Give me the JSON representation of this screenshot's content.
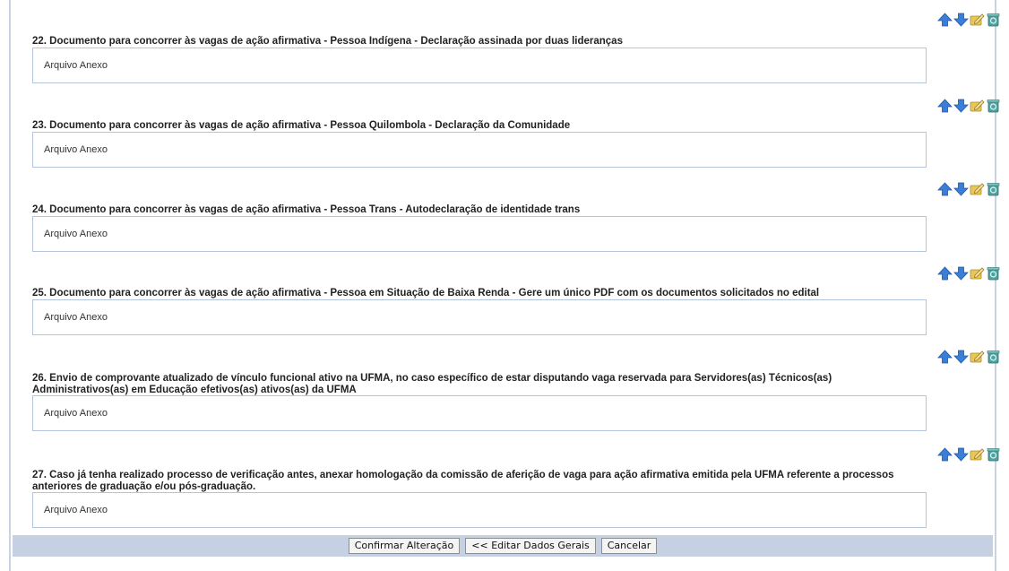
{
  "questions": [
    {
      "label": "22. Documento para concorrer às vagas de ação afirmativa - Pessoa Indígena - Declaração assinada por duas lideranças",
      "answer": "Arquivo Anexo"
    },
    {
      "label": "23. Documento para concorrer às vagas de ação afirmativa - Pessoa Quilombola - Declaração da Comunidade",
      "answer": "Arquivo Anexo"
    },
    {
      "label": "24. Documento para concorrer às vagas de ação afirmativa - Pessoa Trans - Autodeclaração de identidade trans",
      "answer": "Arquivo Anexo"
    },
    {
      "label": "25. Documento para concorrer às vagas de ação afirmativa - Pessoa em Situação de Baixa Renda - Gere um único PDF com os documentos solicitados no edital",
      "answer": "Arquivo Anexo"
    },
    {
      "label": "26. Envio de comprovante atualizado de vínculo funcional ativo na UFMA, no caso específico de estar disputando vaga reservada para Servidores(as) Técnicos(as) Administrativos(as) em Educação efetivos(as) ativos(as) da UFMA",
      "answer": "Arquivo Anexo"
    },
    {
      "label": "27. Caso já tenha realizado processo de verificação antes, anexar homologação da comissão de aferição de vaga para ação afirmativa emitida pela UFMA referente a processos anteriores de graduação e/ou pós-graduação.",
      "answer": "Arquivo Anexo"
    }
  ],
  "icons": [
    "move-up-icon",
    "move-down-icon",
    "edit-icon",
    "delete-icon"
  ],
  "footer": {
    "confirm_label": "Confirmar Alteração",
    "back_label": "<< Editar Dados Gerais",
    "cancel_label": "Cancelar"
  },
  "colors": {
    "footer_bar": "#c5d0e2",
    "box_border": "#b5c5dd",
    "arrow_blue": "#3a7fd5",
    "edit_yellow": "#e8c75a",
    "delete_teal": "#4fa3a0"
  }
}
